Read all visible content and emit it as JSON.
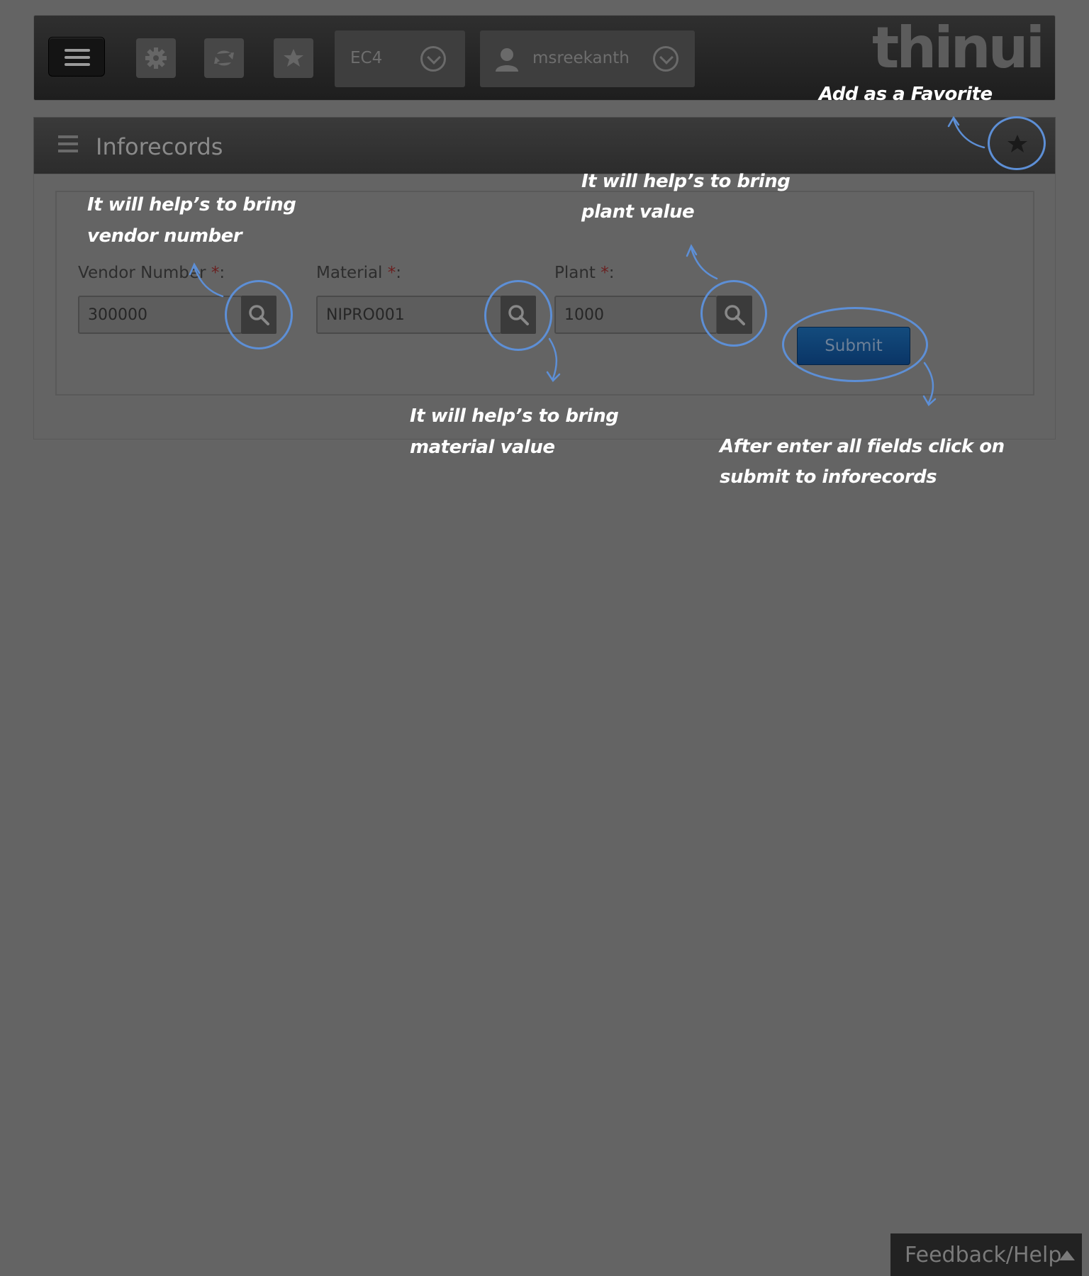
{
  "topbar": {
    "system_label": "EC4",
    "user_label": "msreekanth",
    "brand": "thinui"
  },
  "page": {
    "title": "Inforecords"
  },
  "form": {
    "vendor": {
      "label": "Vendor Number",
      "required": "*",
      "suffix": ":",
      "value": "300000"
    },
    "material": {
      "label": "Material",
      "required": "*",
      "suffix": ":",
      "value": "NIPRO001"
    },
    "plant": {
      "label": "Plant",
      "required": "*",
      "suffix": ":",
      "value": "1000"
    },
    "submit_label": "Submit"
  },
  "annotations": {
    "favorite": "Add as a Favorite",
    "vendor_line1": "It will help’s to bring",
    "vendor_line2": "vendor number",
    "plant_line1": "It will help’s to bring",
    "plant_line2": "plant value",
    "material_line1": "It will help’s to bring",
    "material_line2": "material value",
    "submit_line1": "After enter all fields click on",
    "submit_line2": "submit to inforecords"
  },
  "footer": {
    "feedback_label": "Feedback/Help"
  },
  "colors": {
    "overlay": "#646464",
    "annotation_ring": "#5d8fd6",
    "submit": "#0a3566"
  },
  "icons": [
    "menu-icon",
    "gear-icon",
    "swap-icon",
    "star-icon",
    "chevron-down-icon",
    "user-icon",
    "list-icon",
    "search-icon",
    "caret-up-icon"
  ]
}
